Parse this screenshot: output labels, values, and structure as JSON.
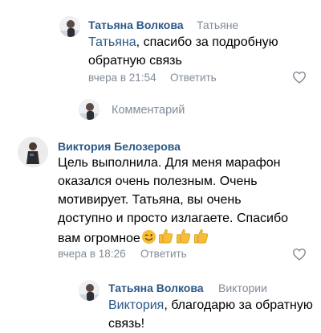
{
  "comments": [
    {
      "author": "Татьяна Волкова",
      "reply_to": "Татьяне",
      "mention": "Татьяна",
      "lines": [
        ", спасибо за подробную",
        "обратную связь"
      ],
      "time": "вчера в 21:54",
      "reply_label": "Ответить"
    },
    {
      "author": "Виктория Белозерова",
      "lines": [
        "Цель выполнила. Для меня марафон",
        "оказался очень полезным. Очень",
        "мотивирует. Татьяна, вы очень",
        "доступно и просто излагаете. Спасибо",
        "вам огромное"
      ],
      "time": "вчера в 18:26",
      "reply_label": "Ответить"
    },
    {
      "author": "Татьяна Волкова",
      "reply_to": "Виктории",
      "mention": "Виктория",
      "lines": [
        ", благодарю за обратную",
        "связь!"
      ],
      "time": "",
      "reply_label": ""
    }
  ],
  "comment_input": {
    "placeholder": "Комментарий"
  },
  "icons": {
    "like": "heart-outline-icon",
    "emoji_wink": "winking-face-icon",
    "emoji_thumbs": "thumbs-up-icon"
  },
  "colors": {
    "link": "#2a5885",
    "secondary": "#818c99",
    "emoji_yellow": "#f6bd37"
  }
}
